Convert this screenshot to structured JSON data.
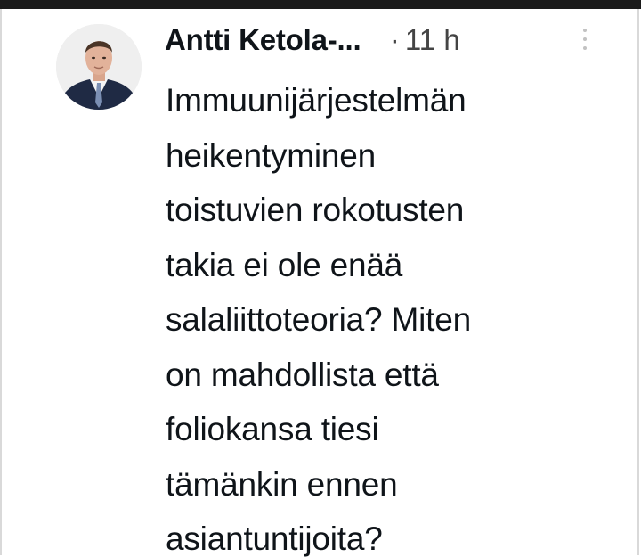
{
  "tweet": {
    "author_name": "Antti Ketola-...",
    "separator": "·",
    "time": "11 h",
    "lines": [
      "Immuunijärjestelmän",
      "heikentyminen",
      "toistuvien rokotusten",
      "takia ei ole enää",
      "salaliittoteoria? Miten",
      "on mahdollista että",
      "foliokansa tiesi",
      "tämänkin ennen",
      "asiantuntijoita?"
    ]
  },
  "icons": {
    "avatar": "profile-photo",
    "more": "vertical-ellipsis-icon"
  },
  "colors": {
    "text": "#0f1419",
    "meta": "#444444",
    "background": "#ffffff"
  }
}
